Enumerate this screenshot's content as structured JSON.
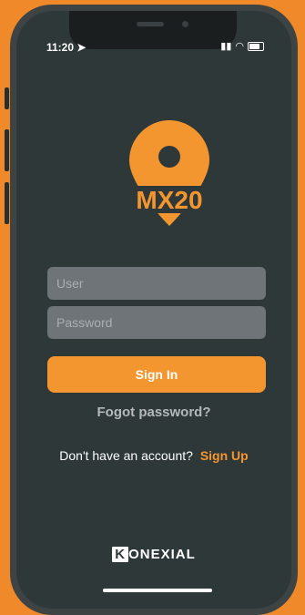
{
  "status": {
    "time": "11:20"
  },
  "logo": {
    "text": "MX20"
  },
  "login": {
    "user_placeholder": "User",
    "password_placeholder": "Password",
    "signin_label": "Sign In",
    "forgot_label": "Fogot password?",
    "no_account_text": "Don't have an account?",
    "signup_label": "Sign Up"
  },
  "brand": {
    "first": "K",
    "rest": "ONEXIAL"
  },
  "colors": {
    "accent": "#f3962f",
    "background": "#2f3839",
    "outer": "#f0892a"
  }
}
